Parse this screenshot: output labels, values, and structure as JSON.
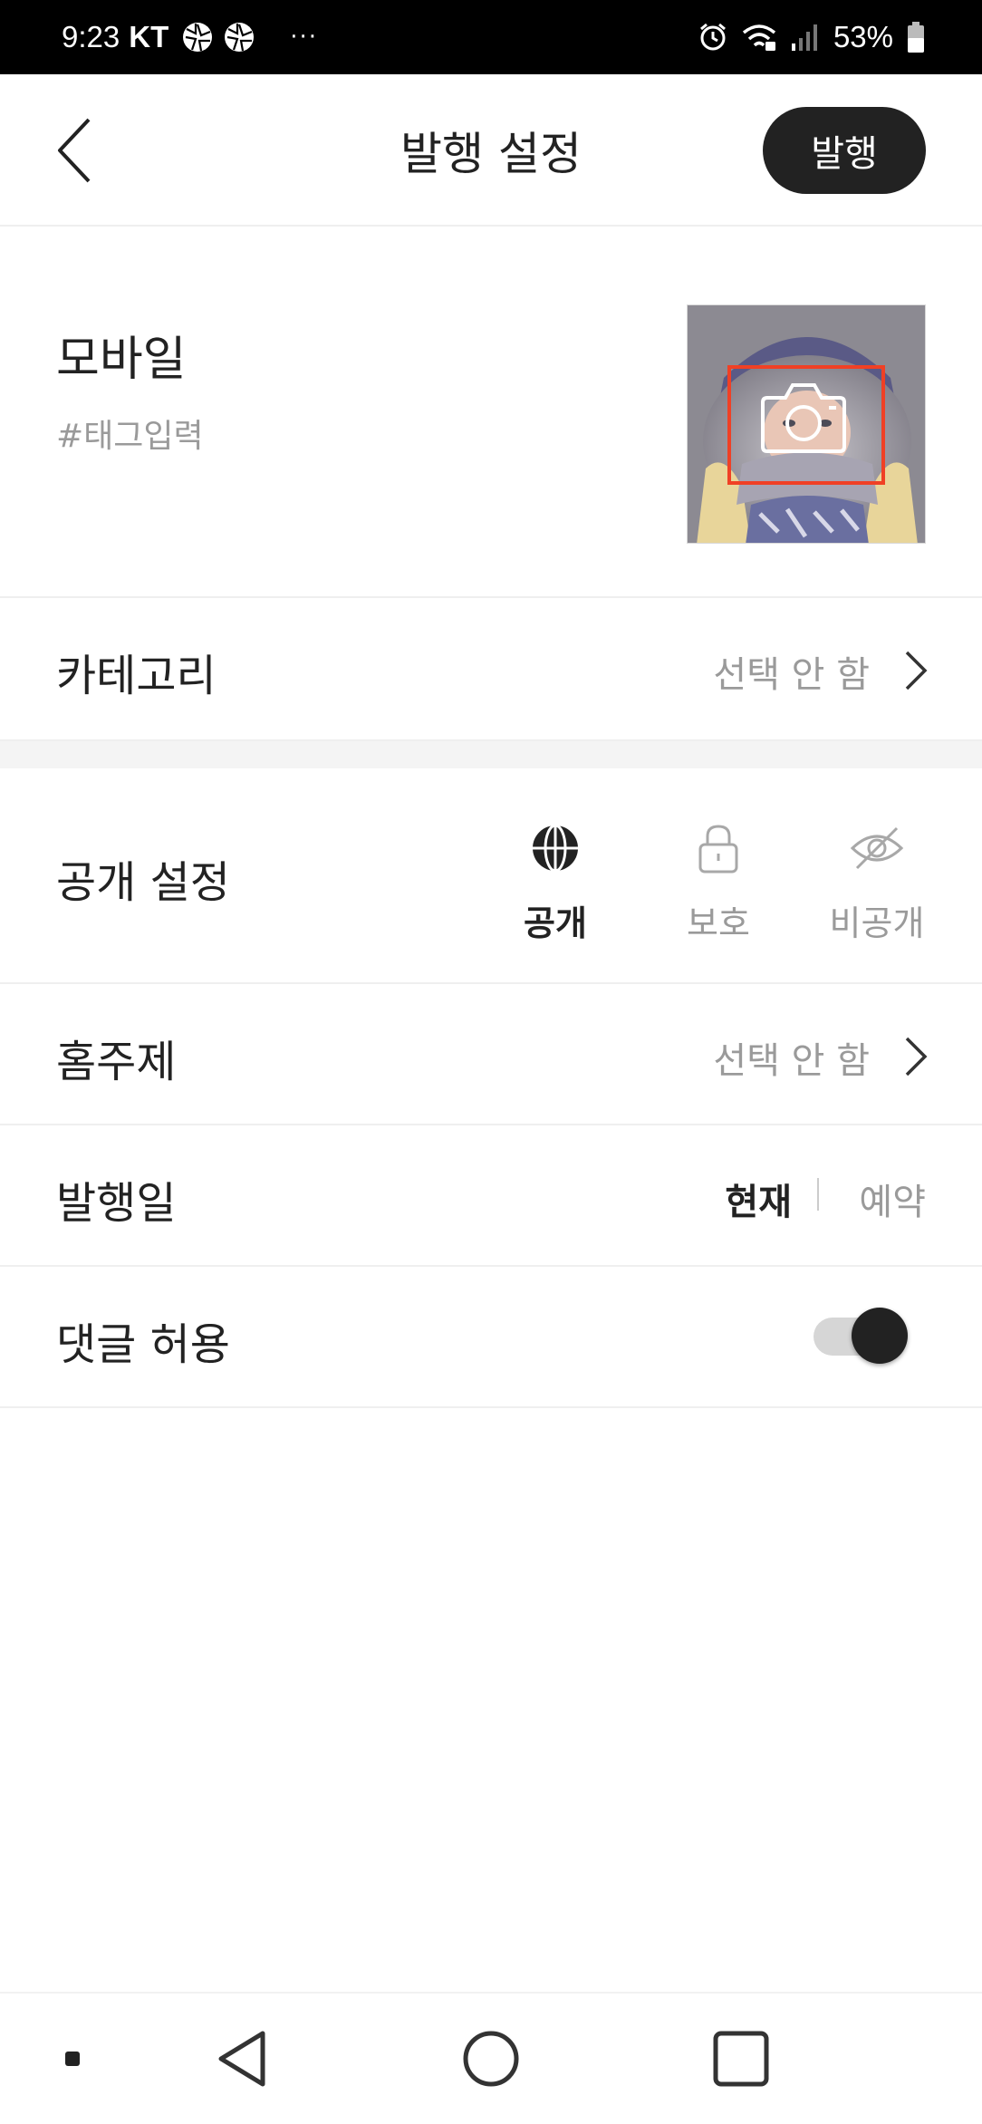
{
  "status_bar": {
    "time": "9:23",
    "carrier": "KT",
    "overflow": "···",
    "battery_percent": "53%",
    "icons": [
      "aperture-icon",
      "aperture-icon",
      "alarm-icon",
      "wifi-icon",
      "signal-icon",
      "battery-icon"
    ]
  },
  "header": {
    "title": "발행 설정",
    "publish_label": "발행",
    "back_icon": "chevron-left-icon"
  },
  "post": {
    "title": "모바일",
    "tag_placeholder": "#태그입력",
    "cover_icon": "camera-icon"
  },
  "category": {
    "label": "카테고리",
    "value": "선택 안 함"
  },
  "visibility": {
    "label": "공개 설정",
    "options": [
      {
        "label": "공개",
        "icon": "globe-icon",
        "selected": true
      },
      {
        "label": "보호",
        "icon": "lock-icon",
        "selected": false
      },
      {
        "label": "비공개",
        "icon": "eye-off-icon",
        "selected": false
      }
    ]
  },
  "home_topic": {
    "label": "홈주제",
    "value": "선택 안 함"
  },
  "publish_date": {
    "label": "발행일",
    "now_label": "현재",
    "scheduled_label": "예약",
    "selected": "now"
  },
  "comments": {
    "label": "댓글 허용",
    "enabled": true
  },
  "nav_bar": {
    "icons": [
      "recents-dot-icon",
      "back-triangle-icon",
      "home-circle-icon",
      "overview-square-icon"
    ]
  },
  "colors": {
    "primary_dark": "#222222",
    "secondary_text": "#9a9a9a",
    "divider": "#efefef",
    "highlight": "#f04025"
  }
}
